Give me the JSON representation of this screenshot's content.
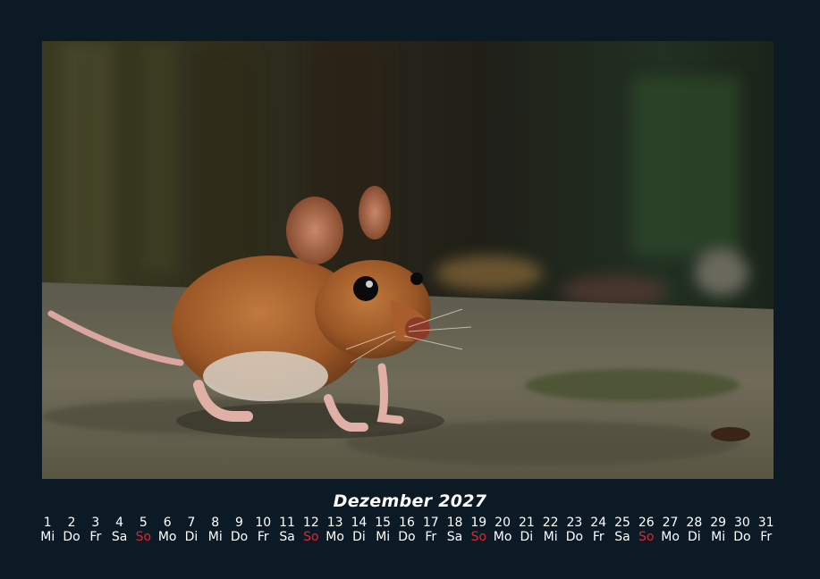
{
  "calendar": {
    "month_title": "Dezember 2027",
    "accent_sunday_color": "#e0262b",
    "days": [
      {
        "num": "1",
        "wd": "Mi"
      },
      {
        "num": "2",
        "wd": "Do"
      },
      {
        "num": "3",
        "wd": "Fr"
      },
      {
        "num": "4",
        "wd": "Sa"
      },
      {
        "num": "5",
        "wd": "So"
      },
      {
        "num": "6",
        "wd": "Mo"
      },
      {
        "num": "7",
        "wd": "Di"
      },
      {
        "num": "8",
        "wd": "Mi"
      },
      {
        "num": "9",
        "wd": "Do"
      },
      {
        "num": "10",
        "wd": "Fr"
      },
      {
        "num": "11",
        "wd": "Sa"
      },
      {
        "num": "12",
        "wd": "So"
      },
      {
        "num": "13",
        "wd": "Mo"
      },
      {
        "num": "14",
        "wd": "Di"
      },
      {
        "num": "15",
        "wd": "Mi"
      },
      {
        "num": "16",
        "wd": "Do"
      },
      {
        "num": "17",
        "wd": "Fr"
      },
      {
        "num": "18",
        "wd": "Sa"
      },
      {
        "num": "19",
        "wd": "So"
      },
      {
        "num": "20",
        "wd": "Mo"
      },
      {
        "num": "21",
        "wd": "Di"
      },
      {
        "num": "22",
        "wd": "Mi"
      },
      {
        "num": "23",
        "wd": "Do"
      },
      {
        "num": "24",
        "wd": "Fr"
      },
      {
        "num": "25",
        "wd": "Sa"
      },
      {
        "num": "26",
        "wd": "So"
      },
      {
        "num": "27",
        "wd": "Mo"
      },
      {
        "num": "28",
        "wd": "Di"
      },
      {
        "num": "29",
        "wd": "Mi"
      },
      {
        "num": "30",
        "wd": "Do"
      },
      {
        "num": "31",
        "wd": "Fr"
      }
    ]
  }
}
